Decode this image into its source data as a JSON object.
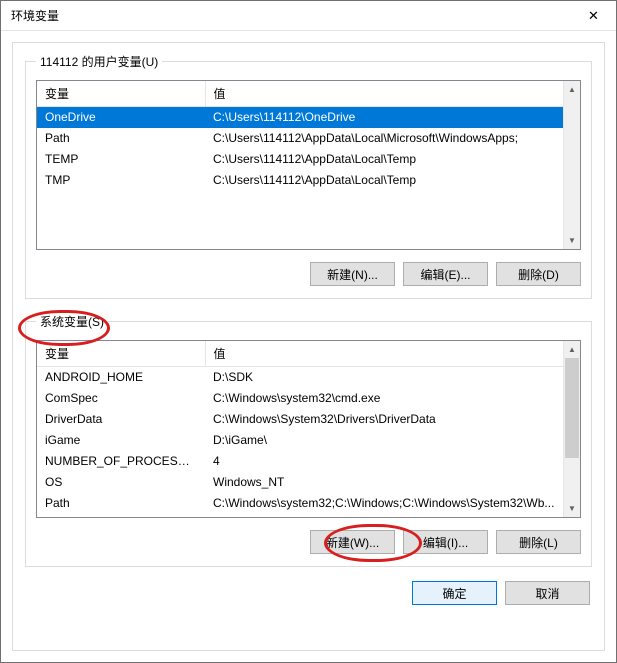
{
  "title": "环境变量",
  "close_icon": "✕",
  "user_group": {
    "legend": "114112 的用户变量(U)",
    "headers": {
      "var": "变量",
      "val": "值"
    },
    "rows": [
      {
        "var": "OneDrive",
        "val": "C:\\Users\\114112\\OneDrive",
        "selected": true
      },
      {
        "var": "Path",
        "val": "C:\\Users\\114112\\AppData\\Local\\Microsoft\\WindowsApps;",
        "selected": false
      },
      {
        "var": "TEMP",
        "val": "C:\\Users\\114112\\AppData\\Local\\Temp",
        "selected": false
      },
      {
        "var": "TMP",
        "val": "C:\\Users\\114112\\AppData\\Local\\Temp",
        "selected": false
      }
    ],
    "buttons": {
      "new": "新建(N)...",
      "edit": "编辑(E)...",
      "delete": "删除(D)"
    }
  },
  "system_group": {
    "legend": "系统变量(S)",
    "headers": {
      "var": "变量",
      "val": "值"
    },
    "rows": [
      {
        "var": "ANDROID_HOME",
        "val": "D:\\SDK"
      },
      {
        "var": "ComSpec",
        "val": "C:\\Windows\\system32\\cmd.exe"
      },
      {
        "var": "DriverData",
        "val": "C:\\Windows\\System32\\Drivers\\DriverData"
      },
      {
        "var": "iGame",
        "val": "D:\\iGame\\"
      },
      {
        "var": "NUMBER_OF_PROCESSORS",
        "val": "4"
      },
      {
        "var": "OS",
        "val": "Windows_NT"
      },
      {
        "var": "Path",
        "val": "C:\\Windows\\system32;C:\\Windows;C:\\Windows\\System32\\Wb..."
      }
    ],
    "buttons": {
      "new": "新建(W)...",
      "edit": "编辑(I)...",
      "delete": "删除(L)"
    }
  },
  "footer": {
    "ok": "确定",
    "cancel": "取消"
  },
  "scroll": {
    "up": "▲",
    "down": "▼"
  }
}
